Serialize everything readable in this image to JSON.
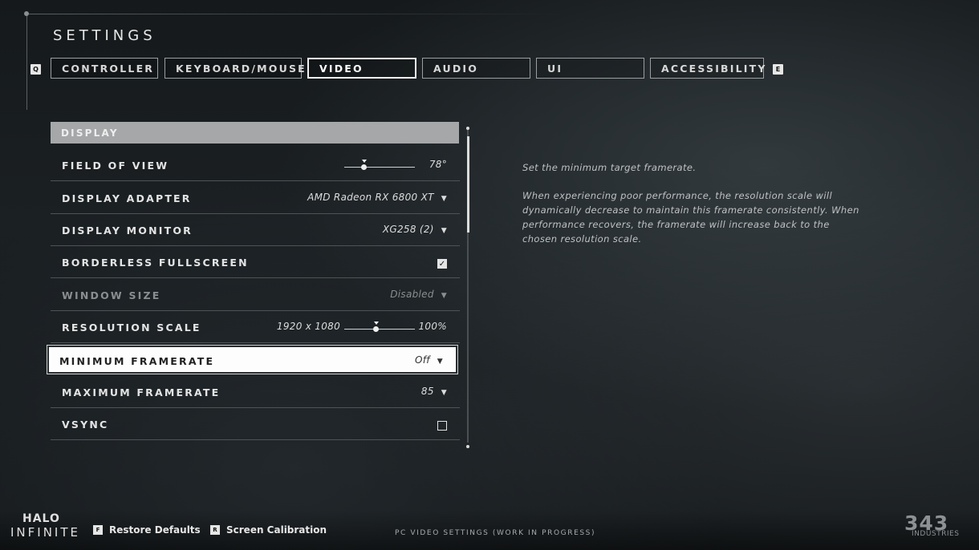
{
  "title": "SETTINGS",
  "tab_keys": {
    "left": "Q",
    "right": "E"
  },
  "tabs": [
    {
      "label": "CONTROLLER",
      "active": false
    },
    {
      "label": "KEYBOARD/MOUSE",
      "active": false
    },
    {
      "label": "VIDEO",
      "active": true
    },
    {
      "label": "AUDIO",
      "active": false
    },
    {
      "label": "UI",
      "active": false
    },
    {
      "label": "ACCESSIBILITY",
      "active": false
    }
  ],
  "section": {
    "header": "DISPLAY"
  },
  "rows": {
    "fov": {
      "label": "FIELD OF VIEW",
      "value": "78°",
      "slider_level": 0.28
    },
    "adapter": {
      "label": "DISPLAY ADAPTER",
      "value": "AMD Radeon RX 6800 XT",
      "icon": "chevron-down-icon"
    },
    "monitor": {
      "label": "DISPLAY MONITOR",
      "value": "XG258 (2)",
      "icon": "chevron-down-icon"
    },
    "borderless": {
      "label": "BORDERLESS FULLSCREEN",
      "checked": true
    },
    "window_size": {
      "label": "WINDOW SIZE",
      "value": "Disabled",
      "disabled": true
    },
    "resolution": {
      "label": "RESOLUTION SCALE",
      "resolution": "1920 x 1080",
      "value": "100%",
      "slider_level": 0.45
    },
    "min_framerate": {
      "label": "MINIMUM FRAMERATE",
      "value": "Off",
      "selected": true
    },
    "max_framerate": {
      "label": "MAXIMUM FRAMERATE",
      "value": "85"
    },
    "vsync": {
      "label": "VSYNC",
      "checked": false
    }
  },
  "description": {
    "line1": "Set the minimum target framerate.",
    "paragraph": [
      "When experiencing poor performance, the resolution scale will",
      "dynamically decrease to maintain this framerate consistently. When",
      "performance recovers, the framerate will increase back to the",
      "chosen resolution scale."
    ]
  },
  "footer": {
    "logo_halo": "HALO",
    "logo_infinite": "INFINITE",
    "restore": {
      "key": "F",
      "label": "Restore Defaults"
    },
    "calibration": {
      "key": "R",
      "label": "Screen Calibration"
    },
    "center_text": "PC VIDEO SETTINGS (WORK IN PROGRESS)",
    "logo_343": "343",
    "logo_industries": "INDUSTRIES"
  },
  "colors": {
    "accent": "#ffffff",
    "section_bg": "#a5a7a8",
    "bg": "#1b2023"
  }
}
